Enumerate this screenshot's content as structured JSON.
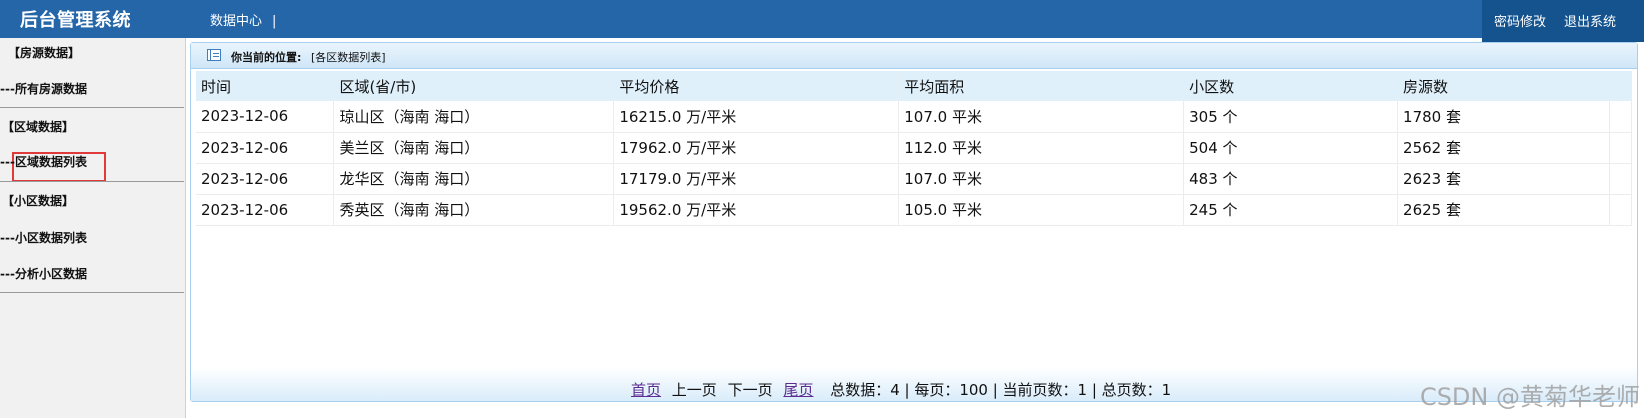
{
  "header": {
    "brand": "后台管理系统",
    "nav_item": "数据中心",
    "nav_sep": "|",
    "change_password": "密码修改",
    "logout": "退出系统"
  },
  "sidebar": {
    "groups": [
      {
        "title": "【房源数据】",
        "items": [
          "---所有房源数据"
        ]
      },
      {
        "title": "【区域数据】",
        "items": [
          "---区域数据列表"
        ]
      },
      {
        "title": "【小区数据】",
        "items": [
          "---小区数据列表",
          "---分析小区数据"
        ]
      }
    ],
    "active_item": "---区域数据列表"
  },
  "panel": {
    "location_label": "你当前的位置:",
    "location_path": "[各区数据列表]"
  },
  "table": {
    "headers": [
      "时间",
      "区域(省/市)",
      "平均价格",
      "平均面积",
      "小区数",
      "房源数"
    ],
    "rows": [
      [
        "2023-12-06",
        "琼山区（海南 海口）",
        "16215.0 万/平米",
        "107.0 平米",
        "305 个",
        "1780 套"
      ],
      [
        "2023-12-06",
        "美兰区（海南 海口）",
        "17962.0 万/平米",
        "112.0 平米",
        "504 个",
        "2562 套"
      ],
      [
        "2023-12-06",
        "龙华区（海南 海口）",
        "17179.0 万/平米",
        "107.0 平米",
        "483 个",
        "2623 套"
      ],
      [
        "2023-12-06",
        "秀英区（海南 海口）",
        "19562.0 万/平米",
        "105.0 平米",
        "245 个",
        "2625 套"
      ]
    ]
  },
  "pager": {
    "first": "首页",
    "prev": "上一页",
    "next": "下一页",
    "last": "尾页",
    "summary": "总数据：4 | 每页：100 | 当前页数：1 | 总页数：1"
  },
  "watermark": "CSDN @黄菊华老师",
  "colors": {
    "topbar": "#2566a8",
    "topbar_right": "#15538f",
    "highlight_border": "#e03a3a"
  }
}
